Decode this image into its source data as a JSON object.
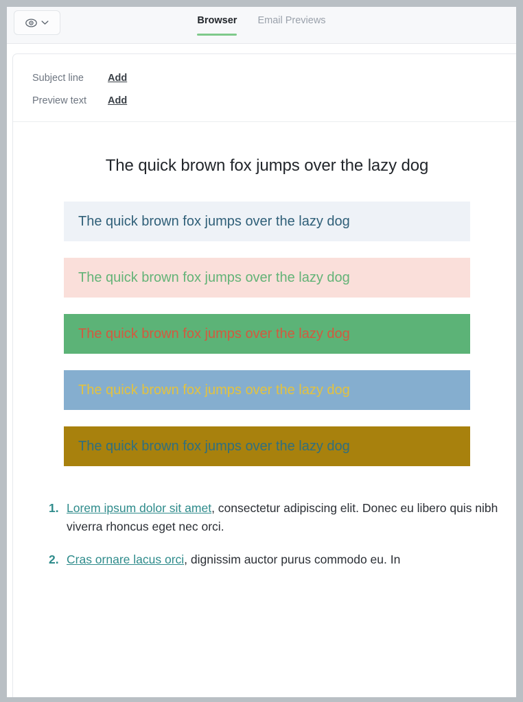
{
  "toolbar": {
    "preview_mode_icon": "eye-icon",
    "dropdown_icon": "chevron-down-icon",
    "tabs": [
      {
        "label": "Browser",
        "active": true
      },
      {
        "label": "Email Previews",
        "active": false
      }
    ],
    "active_tab_underline_color": "#7ec98a"
  },
  "meta": {
    "rows": [
      {
        "label": "Subject line",
        "action": "Add"
      },
      {
        "label": "Preview text",
        "action": "Add"
      }
    ]
  },
  "email": {
    "headline": "The quick brown fox jumps over the lazy dog",
    "sample_text": "The quick brown fox jumps over the lazy dog",
    "bands": [
      {
        "name": "band-light-blue",
        "bg": "#eef2f7",
        "fg": "#2f5f78"
      },
      {
        "name": "band-pink",
        "bg": "#fadfda",
        "fg": "#63b377"
      },
      {
        "name": "band-green",
        "bg": "#5cb377",
        "fg": "#d4593f"
      },
      {
        "name": "band-steel-blue",
        "bg": "#85aecf",
        "fg": "#e3c23f"
      },
      {
        "name": "band-gold",
        "bg": "#a8810d",
        "fg": "#2f6f80"
      }
    ],
    "list": [
      {
        "number": "1.",
        "link": "Lorem ipsum dolor sit amet",
        "rest": ", consectetur adipiscing elit. Donec eu libero quis nibh viverra rhoncus eget nec orci."
      },
      {
        "number": "2.",
        "link": "Cras ornare lacus orci",
        "rest": ", dignissim auctor purus commodo eu. In"
      }
    ],
    "link_color": "#2e8b8b"
  }
}
